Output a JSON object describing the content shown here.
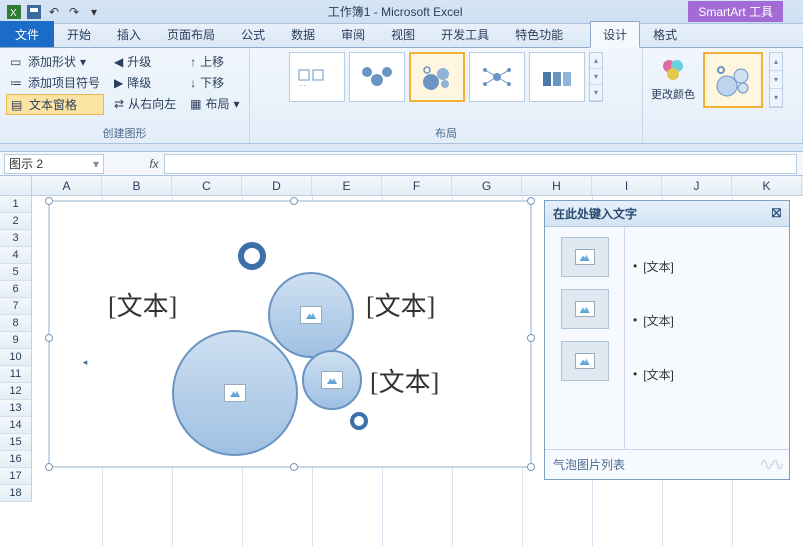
{
  "app": {
    "title": "工作簿1 - Microsoft Excel"
  },
  "contextual": {
    "smartart_tools": "SmartArt 工具"
  },
  "tabs": {
    "file": "文件",
    "home": "开始",
    "insert": "插入",
    "pagelayout": "页面布局",
    "formulas": "公式",
    "data": "数据",
    "review": "审阅",
    "view": "视图",
    "developer": "开发工具",
    "special": "特色功能",
    "design": "设计",
    "format": "格式"
  },
  "ribbon": {
    "create_graphic": {
      "label": "创建图形",
      "add_shape": "添加形状",
      "add_bullet": "添加项目符号",
      "text_pane": "文本窗格",
      "promote": "升级",
      "demote": "降级",
      "rtl": "从右向左",
      "move_up": "上移",
      "move_down": "下移",
      "layout": "布局"
    },
    "layouts": {
      "label": "布局"
    },
    "styles": {
      "change_colors": "更改颜色"
    }
  },
  "formula_bar": {
    "name_box": "图示 2",
    "fx": "fx"
  },
  "columns": [
    "A",
    "B",
    "C",
    "D",
    "E",
    "F",
    "G",
    "H",
    "I",
    "J",
    "K"
  ],
  "rows": [
    1,
    2,
    3,
    4,
    5,
    6,
    7,
    8,
    9,
    10,
    11,
    12,
    13,
    14,
    15,
    16,
    17,
    18
  ],
  "smartart": {
    "placeholder": "[文本]"
  },
  "textpane": {
    "title": "在此处键入文字",
    "items": [
      "[文本]",
      "[文本]",
      "[文本]"
    ],
    "footer": "气泡图片列表"
  },
  "colors": {
    "accent": "#3d6fa8",
    "ribbon_bg": "#e8f0fa",
    "highlight": "#f3b13a"
  }
}
